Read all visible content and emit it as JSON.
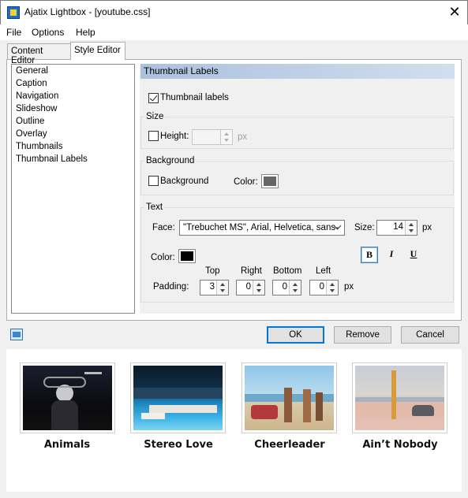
{
  "window": {
    "title": "Ajatix Lightbox - [youtube.css]"
  },
  "menu": [
    "File",
    "Options",
    "Help"
  ],
  "tabs": [
    {
      "label": "Content Editor",
      "active": false
    },
    {
      "label": "Style Editor",
      "active": true
    }
  ],
  "sidebar": {
    "items": [
      {
        "label": "General",
        "selected": false
      },
      {
        "label": "Caption",
        "selected": false
      },
      {
        "label": "Navigation",
        "selected": false
      },
      {
        "label": "Slideshow",
        "selected": false
      },
      {
        "label": "Outline",
        "selected": false
      },
      {
        "label": "Overlay",
        "selected": false
      },
      {
        "label": "Thumbnails",
        "selected": false
      },
      {
        "label": "Thumbnail Labels",
        "selected": true
      }
    ]
  },
  "panel": {
    "header": "Thumbnail Labels",
    "enable_label": "Thumbnail labels",
    "enable_checked": true,
    "size": {
      "group": "Size",
      "height_label": "Height:",
      "height_checked": false,
      "height_value": "",
      "unit": "px"
    },
    "background": {
      "group": "Background",
      "bg_label": "Background",
      "bg_checked": false,
      "color_label": "Color:",
      "color": "#666666"
    },
    "text": {
      "group": "Text",
      "face_label": "Face:",
      "face_value": "\"Trebuchet MS\", Arial, Helvetica, sans-",
      "size_label": "Size:",
      "size_value": "14",
      "size_unit": "px",
      "color_label": "Color:",
      "color": "#000000",
      "bold": "B",
      "italic": "I",
      "underline": "U",
      "bold_pressed": true,
      "padding_label": "Padding:",
      "padding_unit": "px",
      "padding": {
        "top_label": "Top",
        "top": "3",
        "right_label": "Right",
        "right": "0",
        "bottom_label": "Bottom",
        "bottom": "0",
        "left_label": "Left",
        "left": "0"
      }
    }
  },
  "buttons": {
    "ok": "OK",
    "remove": "Remove",
    "cancel": "Cancel"
  },
  "preview": {
    "items": [
      {
        "label": "Animals"
      },
      {
        "label": "Stereo Love"
      },
      {
        "label": "Cheerleader"
      },
      {
        "label": "Ain’t Nobody"
      }
    ]
  },
  "colors": {
    "accent": "#0078d7",
    "header_gradient_start": "#abc1dd",
    "selection": "#0078d7"
  }
}
